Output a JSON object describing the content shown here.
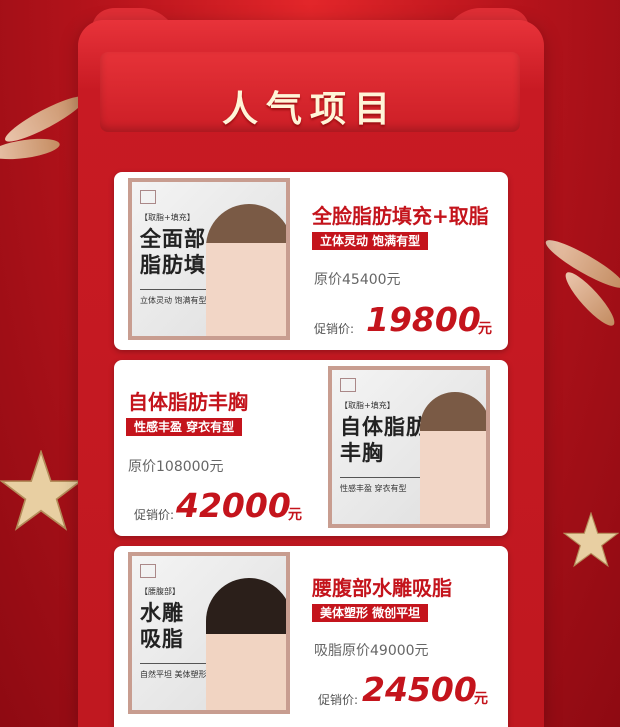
{
  "header": {
    "title": "人气项目"
  },
  "items": [
    {
      "name": "全脸脂肪填充+取脂",
      "tagline": "立体灵动  饱满有型",
      "original_price": "原价45400元",
      "promo_label": "促销价:",
      "promo_price": "19800",
      "unit": "元",
      "thumb": {
        "tag": "【取脂+填充】",
        "headline": "全面部\n脂肪填充",
        "sub": "立体灵动   饱满有型"
      }
    },
    {
      "name": "自体脂肪丰胸",
      "tagline": "性感丰盈  穿衣有型",
      "original_price": "原价108000元",
      "promo_label": "促销价:",
      "promo_price": "42000",
      "unit": "元",
      "thumb": {
        "tag": "【取脂+填充】",
        "headline": "自体脂肪\n丰胸",
        "sub": "性感丰盈   穿衣有型"
      }
    },
    {
      "name": "腰腹部水雕吸脂",
      "tagline": "美体塑形  微创平坦",
      "original_price": "吸脂原价49000元",
      "promo_label": "促销价:",
      "promo_price": "24500",
      "unit": "元",
      "thumb": {
        "tag": "【腰腹部】",
        "headline": "水雕\n吸脂",
        "sub": "自然平坦   美体塑形"
      }
    }
  ],
  "colors": {
    "accent": "#c4141c",
    "background": "#b8141c",
    "title_text": "#fff5d8"
  }
}
